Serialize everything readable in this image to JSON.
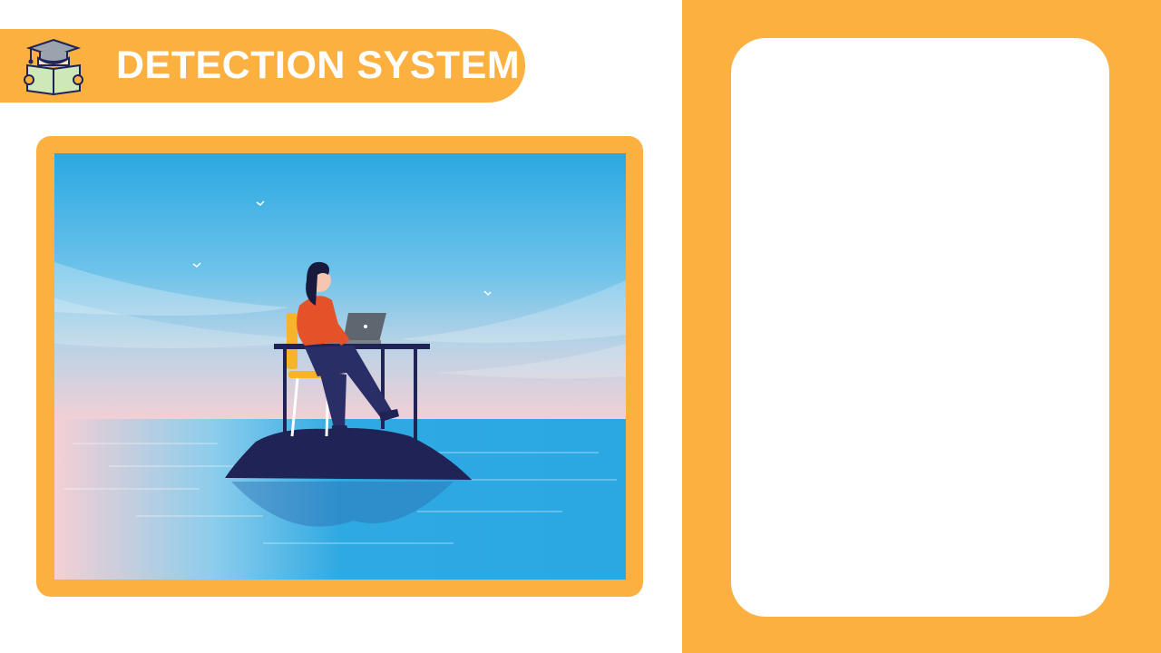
{
  "header": {
    "title": "DETECTION SYSTEM",
    "icon": "graduate-reading-book-icon"
  },
  "illustration": {
    "subject": "woman-working-on-laptop-at-desk-on-island-illustration"
  },
  "colors": {
    "accent": "#FBB040",
    "sky": "#2AA8E2",
    "island": "#1F2356"
  }
}
